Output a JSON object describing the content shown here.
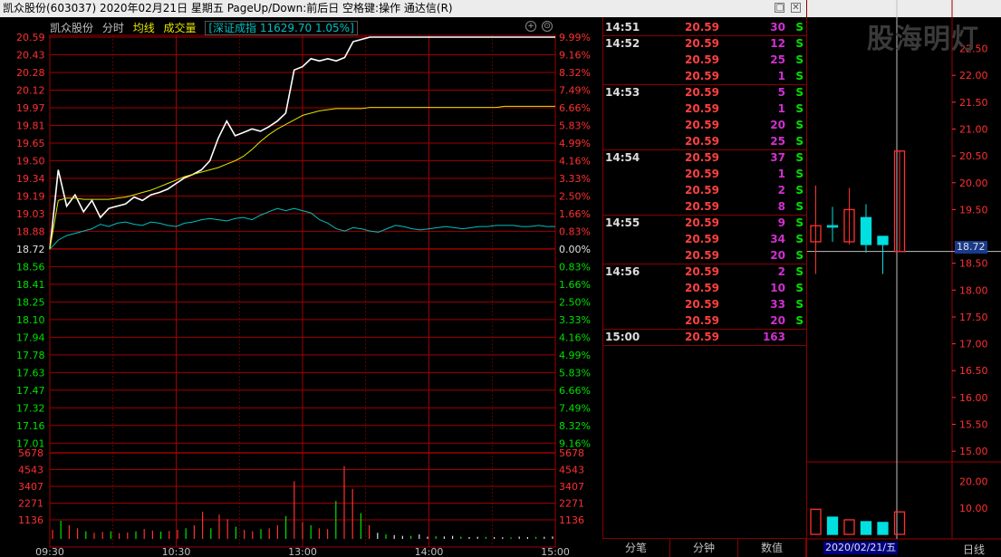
{
  "window": {
    "title": "凯众股份(603037)  2020年02月21日 星期五  PageUp/Down:前后日  空格键:操作  通达信(R)"
  },
  "chart_header": {
    "stock_name": "凯众股份",
    "tab_minute": "分时",
    "label_avg": "均线",
    "label_volume": "成交量",
    "index_info": "[深证成指 11629.70 1.05%]"
  },
  "colors": {
    "up": "#ff3030",
    "down": "#00e000",
    "grid": "#a00000",
    "price_line": "#ffffff",
    "avg_line": "#e5e500",
    "index_line": "#00c0c0"
  },
  "chart_data": {
    "type": "line",
    "x_ticks": [
      "09:30",
      "10:30",
      "13:00",
      "14:00",
      "15:00"
    ],
    "price_axis_left": [
      "20.59",
      "20.43",
      "20.28",
      "20.12",
      "19.97",
      "19.81",
      "19.65",
      "19.50",
      "19.34",
      "19.19",
      "19.03",
      "18.88",
      "18.72",
      "18.56",
      "18.41",
      "18.25",
      "18.10",
      "17.94",
      "17.78",
      "17.63",
      "17.47",
      "17.32",
      "17.16",
      "17.01"
    ],
    "pct_axis_right": [
      "9.99%",
      "9.16%",
      "8.32%",
      "7.49%",
      "6.66%",
      "5.83%",
      "4.99%",
      "4.16%",
      "3.33%",
      "2.50%",
      "1.66%",
      "0.83%",
      "0.00%",
      "0.83%",
      "1.66%",
      "2.50%",
      "3.33%",
      "4.16%",
      "4.99%",
      "5.83%",
      "6.66%",
      "7.49%",
      "8.32%",
      "9.16%"
    ],
    "volume_axis": [
      "5678",
      "4543",
      "3407",
      "2271",
      "1136"
    ],
    "prev_close": 18.72,
    "price_max": 20.59,
    "price_min": 17.01,
    "volume_max": 5678,
    "series": [
      {
        "name": "分时",
        "values": [
          18.72,
          19.42,
          19.1,
          19.2,
          19.05,
          19.15,
          19.0,
          19.08,
          19.1,
          19.12,
          19.18,
          19.15,
          19.2,
          19.22,
          19.25,
          19.3,
          19.35,
          19.38,
          19.42,
          19.5,
          19.7,
          19.85,
          19.72,
          19.75,
          19.78,
          19.76,
          19.8,
          19.85,
          19.92,
          20.3,
          20.33,
          20.4,
          20.38,
          20.4,
          20.38,
          20.41,
          20.55,
          20.57,
          20.59,
          20.59,
          20.59,
          20.59,
          20.59,
          20.59,
          20.59,
          20.59,
          20.59,
          20.59,
          20.59,
          20.59,
          20.59,
          20.59,
          20.59,
          20.59,
          20.59,
          20.59,
          20.59,
          20.59,
          20.59,
          20.59,
          20.59
        ]
      },
      {
        "name": "均线",
        "values": [
          18.72,
          19.15,
          19.17,
          19.17,
          19.16,
          19.16,
          19.16,
          19.16,
          19.17,
          19.18,
          19.2,
          19.22,
          19.24,
          19.27,
          19.3,
          19.33,
          19.36,
          19.38,
          19.4,
          19.42,
          19.44,
          19.47,
          19.5,
          19.54,
          19.6,
          19.67,
          19.73,
          19.78,
          19.82,
          19.86,
          19.9,
          19.92,
          19.94,
          19.95,
          19.96,
          19.96,
          19.96,
          19.96,
          19.97,
          19.97,
          19.97,
          19.97,
          19.97,
          19.97,
          19.97,
          19.97,
          19.97,
          19.97,
          19.97,
          19.97,
          19.97,
          19.97,
          19.97,
          19.97,
          19.98,
          19.98,
          19.98,
          19.98,
          19.98,
          19.98,
          19.98
        ]
      },
      {
        "name": "深证成指",
        "values": [
          18.72,
          18.8,
          18.84,
          18.86,
          18.88,
          18.9,
          18.94,
          18.92,
          18.95,
          18.96,
          18.94,
          18.93,
          18.96,
          18.95,
          18.93,
          18.92,
          18.95,
          18.96,
          18.98,
          18.99,
          18.98,
          18.97,
          18.99,
          19.0,
          18.98,
          19.02,
          19.05,
          19.08,
          19.06,
          19.08,
          19.06,
          19.04,
          18.98,
          18.95,
          18.9,
          18.88,
          18.91,
          18.9,
          18.88,
          18.87,
          18.9,
          18.93,
          18.92,
          18.9,
          18.89,
          18.9,
          18.91,
          18.92,
          18.91,
          18.9,
          18.91,
          18.92,
          18.92,
          18.93,
          18.93,
          18.93,
          18.92,
          18.92,
          18.93,
          18.92,
          18.92
        ]
      }
    ],
    "volume": [
      600,
      1200,
      900,
      700,
      500,
      400,
      450,
      500,
      380,
      420,
      500,
      650,
      550,
      480,
      520,
      600,
      700,
      900,
      1800,
      700,
      1600,
      1300,
      800,
      600,
      500,
      650,
      700,
      900,
      1500,
      3800,
      1100,
      900,
      700,
      650,
      2500,
      4800,
      3300,
      1700,
      900,
      400,
      300,
      250,
      200,
      200,
      300,
      150,
      180,
      160,
      200,
      150,
      120,
      140,
      130,
      120,
      110,
      100,
      150,
      120,
      130,
      140,
      160
    ]
  },
  "ticks": {
    "groups": [
      {
        "time": "14:51",
        "rows": [
          {
            "price": "20.59",
            "vol": "30",
            "flag": "S"
          }
        ]
      },
      {
        "time": "14:52",
        "rows": [
          {
            "price": "20.59",
            "vol": "12",
            "flag": "S"
          },
          {
            "price": "20.59",
            "vol": "25",
            "flag": "S"
          },
          {
            "price": "20.59",
            "vol": "1",
            "flag": "S"
          }
        ]
      },
      {
        "time": "14:53",
        "rows": [
          {
            "price": "20.59",
            "vol": "5",
            "flag": "S"
          },
          {
            "price": "20.59",
            "vol": "1",
            "flag": "S"
          },
          {
            "price": "20.59",
            "vol": "20",
            "flag": "S"
          },
          {
            "price": "20.59",
            "vol": "25",
            "flag": "S"
          }
        ]
      },
      {
        "time": "14:54",
        "rows": [
          {
            "price": "20.59",
            "vol": "37",
            "flag": "S"
          },
          {
            "price": "20.59",
            "vol": "1",
            "flag": "S"
          },
          {
            "price": "20.59",
            "vol": "2",
            "flag": "S"
          },
          {
            "price": "20.59",
            "vol": "8",
            "flag": "S"
          }
        ]
      },
      {
        "time": "14:55",
        "rows": [
          {
            "price": "20.59",
            "vol": "9",
            "flag": "S"
          },
          {
            "price": "20.59",
            "vol": "34",
            "flag": "S"
          },
          {
            "price": "20.59",
            "vol": "20",
            "flag": "S"
          }
        ]
      },
      {
        "time": "14:56",
        "rows": [
          {
            "price": "20.59",
            "vol": "2",
            "flag": "S"
          },
          {
            "price": "20.59",
            "vol": "10",
            "flag": "S"
          },
          {
            "price": "20.59",
            "vol": "33",
            "flag": "S"
          },
          {
            "price": "20.59",
            "vol": "20",
            "flag": "S"
          }
        ]
      },
      {
        "time": "15:00",
        "rows": [
          {
            "price": "20.59",
            "vol": "163",
            "flag": ""
          }
        ]
      }
    ]
  },
  "bottom_tabs": [
    "分笔",
    "分钟",
    "数值"
  ],
  "kline": {
    "watermark": "股海明灯",
    "price_axis": [
      "22.50",
      "22.00",
      "21.50",
      "21.00",
      "20.50",
      "20.00",
      "19.50",
      "18.50",
      "18.00",
      "17.50",
      "17.00",
      "16.50",
      "16.00",
      "15.50",
      "15.00"
    ],
    "current_price_label": "18.72",
    "vol_axis": [
      "20.00",
      "10.00"
    ],
    "date_label": "2020/02/21/五",
    "period_label": "日线",
    "price_min": 14.8,
    "price_max": 23.1,
    "vol_max": 24,
    "candles": [
      {
        "open": 19.2,
        "close": 18.9,
        "high": 19.95,
        "low": 18.3,
        "vol": 9.5,
        "type": "down_red"
      },
      {
        "open": 19.2,
        "close": 19.2,
        "high": 19.55,
        "low": 18.9,
        "vol": 6.5,
        "type": "flat"
      },
      {
        "open": 18.9,
        "close": 19.5,
        "high": 19.9,
        "low": 18.85,
        "vol": 5.5,
        "type": "up"
      },
      {
        "open": 19.35,
        "close": 18.85,
        "high": 19.6,
        "low": 18.7,
        "vol": 4.8,
        "type": "down"
      },
      {
        "open": 19.0,
        "close": 18.85,
        "high": 19.0,
        "low": 18.3,
        "vol": 4.5,
        "type": "down"
      },
      {
        "open": 18.72,
        "close": 20.59,
        "high": 20.59,
        "low": 18.72,
        "vol": 8.5,
        "type": "up"
      }
    ]
  }
}
